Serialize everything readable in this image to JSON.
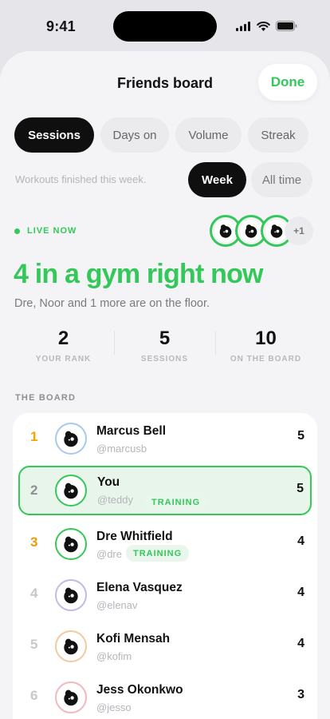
{
  "status": {
    "time": "9:41"
  },
  "sheet": {
    "title": "Friends board",
    "done_label": "Done"
  },
  "metrics": [
    {
      "label": "Sessions",
      "active": true
    },
    {
      "label": "Days on",
      "active": false
    },
    {
      "label": "Volume",
      "active": false
    },
    {
      "label": "Streak",
      "active": false
    }
  ],
  "period": {
    "subtitle": "Workouts finished this week.",
    "options": [
      {
        "label": "Week",
        "active": true
      },
      {
        "label": "All time",
        "active": false
      }
    ]
  },
  "live": {
    "label": "LIVE NOW",
    "extra_count": "+1",
    "headline": "4 in a gym right now",
    "subtext": "Dre, Noor and 1 more are on the floor."
  },
  "stats": [
    {
      "value": "2",
      "label": "YOUR RANK"
    },
    {
      "value": "5",
      "label": "SESSIONS"
    },
    {
      "value": "10",
      "label": "ON THE BOARD"
    }
  ],
  "board": {
    "title": "THE BOARD",
    "rows": [
      {
        "rank": "1",
        "name": "Marcus Bell",
        "handle": "@marcusb",
        "score": "5",
        "badge": "",
        "rank_color": "#f0a500",
        "ring_color": "#a8c8f0"
      },
      {
        "rank": "2",
        "name": "You",
        "handle": "@teddy",
        "score": "5",
        "badge": "TRAINING",
        "rank_color": "#8e8e93",
        "ring_color": "#34c759"
      },
      {
        "rank": "3",
        "name": "Dre Whitfield",
        "handle": "@dre",
        "score": "4",
        "badge": "TRAINING",
        "rank_color": "#f0960a",
        "ring_color": "#34c759"
      },
      {
        "rank": "4",
        "name": "Elena Vasquez",
        "handle": "@elenav",
        "score": "4",
        "badge": "",
        "rank_color": "#c7c7cc",
        "ring_color": "#c5b8e8"
      },
      {
        "rank": "5",
        "name": "Kofi Mensah",
        "handle": "@kofim",
        "score": "4",
        "badge": "",
        "rank_color": "#c7c7cc",
        "ring_color": "#f2c9a0"
      },
      {
        "rank": "6",
        "name": "Jess Okonkwo",
        "handle": "@jesso",
        "score": "3",
        "badge": "",
        "rank_color": "#c7c7cc",
        "ring_color": "#f2b8c0"
      }
    ]
  },
  "colors": {
    "accent": "#34c759",
    "dark": "#0f0f10"
  }
}
